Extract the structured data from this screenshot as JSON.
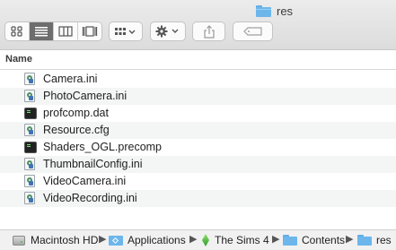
{
  "window": {
    "title": "res"
  },
  "toolbar": {
    "view_modes": [
      {
        "name": "icon-view",
        "active": false
      },
      {
        "name": "list-view",
        "active": true
      },
      {
        "name": "column-view",
        "active": false
      },
      {
        "name": "gallery-view",
        "active": false
      }
    ],
    "group_button": "grid-group-icon",
    "action_button": "gear-icon",
    "share_button": "share-icon",
    "tags_button": "tag-icon"
  },
  "columns": {
    "name": "Name"
  },
  "files": [
    {
      "name": "Camera.ini",
      "icon": "doc"
    },
    {
      "name": "PhotoCamera.ini",
      "icon": "doc"
    },
    {
      "name": "profcomp.dat",
      "icon": "terminal"
    },
    {
      "name": "Resource.cfg",
      "icon": "doc"
    },
    {
      "name": "Shaders_OGL.precomp",
      "icon": "terminal"
    },
    {
      "name": "ThumbnailConfig.ini",
      "icon": "doc"
    },
    {
      "name": "VideoCamera.ini",
      "icon": "doc"
    },
    {
      "name": "VideoRecording.ini",
      "icon": "doc"
    }
  ],
  "path": {
    "items": [
      "Macintosh HD",
      "Applications",
      "The Sims 4",
      "Contents",
      "res"
    ],
    "separator": "▶"
  },
  "colors": {
    "folder": "#6cb6ec",
    "active_segment": "#6d6d6d"
  }
}
